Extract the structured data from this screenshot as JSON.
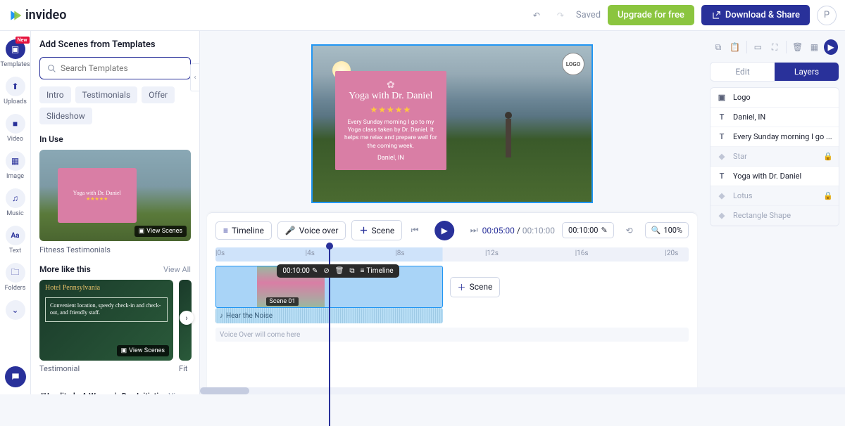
{
  "brand": "invideo",
  "top": {
    "saved": "Saved",
    "upgrade": "Upgrade for free",
    "download": "Download & Share",
    "avatar": "P"
  },
  "nav": {
    "badge_new": "New",
    "templates": "Templates",
    "uploads": "Uploads",
    "video": "Video",
    "image": "Image",
    "music": "Music",
    "text": "Text",
    "folders": "Folders"
  },
  "side": {
    "heading": "Add Scenes from Templates",
    "search_placeholder": "Search Templates",
    "chips": {
      "intro": "Intro",
      "testimonials": "Testimonials",
      "offer": "Offer",
      "slideshow": "Slideshow"
    },
    "in_use": "In Use",
    "view_scenes": "View Scenes",
    "fitness_caption": "Fitness Testimonials",
    "fit_title": "Yoga with Dr. Daniel",
    "more": "More like this",
    "view_all": "View All",
    "hotel_name": "Hotel Pennsylvania",
    "hotel_quote": "Convenient location, speedy check-in and check-out, and friendly staff.",
    "testimonial_caption": "Testimonial",
    "fit_short": "Fit",
    "campaign": "#Unedited - A Women's Day Initiative"
  },
  "canvas": {
    "logo_badge": "LOGO",
    "card_title": "Yoga with Dr. Daniel",
    "stars": "★★★★★",
    "body": "Every Sunday morning I go to my Yoga class taken by Dr. Daniel. It helps me relax and prepare well for the coming week.",
    "author": "Daniel, IN"
  },
  "timeline": {
    "btn_timeline": "Timeline",
    "btn_voice": "Voice over",
    "btn_scene": "Scene",
    "current": "00:05:00",
    "total": "00:10:00",
    "pill_time": "00:10:00",
    "zoom": "100%",
    "r0": "|0s",
    "r4": "|4s",
    "r8": "|8s",
    "r12": "|12s",
    "r16": "|16s",
    "r20": "|20s",
    "clip_time": "00:10:00",
    "clip_timeline": "Timeline",
    "scene_label": "Scene 01",
    "scene_add": "Scene",
    "audio": "Hear the Noise",
    "vo_placeholder": "Voice Over will come here"
  },
  "layers": {
    "tab_edit": "Edit",
    "tab_layers": "Layers",
    "logo": "Logo",
    "daniel": "Daniel, IN",
    "every": "Every Sunday morning I go ...",
    "star": "Star",
    "yoga": "Yoga with Dr. Daniel",
    "lotus": "Lotus",
    "rect": "Rectangle Shape"
  }
}
